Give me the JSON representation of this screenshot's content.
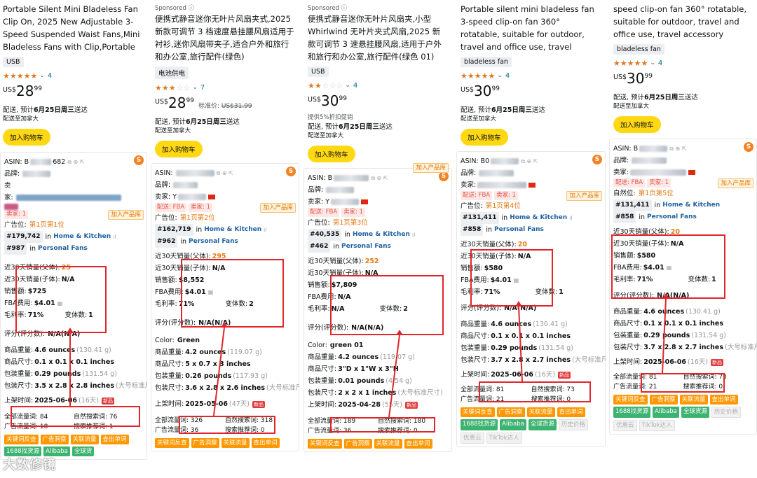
{
  "products": [
    {
      "title": "Portable Silent Mini Bladeless Fan Clip On, 2025 New Adjustable 3-Speed Suspended Waist Fans,Mini Bladeless Fans with Clip,Portable f...",
      "sponsored": "",
      "tag": "USB",
      "rating_stars": 5,
      "rating_count": "4",
      "currency": "US$",
      "price_main": "28",
      "price_frac": "99",
      "list_label": "",
      "list_price": "",
      "promo": "",
      "ship_prefix": "配送, 预计",
      "ship_date": "6月25日周三",
      "ship_suffix": "送达",
      "ship_to": "配送至加拿大",
      "cart": "加入购物车",
      "asin_label": "ASIN: B",
      "asin_tail": "682",
      "brand_label": "品牌:",
      "seller_label": "卖",
      "seller_label2": "家:",
      "fba_chip": "",
      "seller_count_chip": "卖家: 1",
      "add_btn": "加入产品库",
      "ad_pos_label": "广告位:",
      "ad_pos": "第1页第1位",
      "rank1_no": "#179,742",
      "rank1_in": "in",
      "rank1_cat": "Home & Kitchen",
      "rank2_no": "#987",
      "rank2_in": "in",
      "rank2_cat": "Personal Fans",
      "sales_parent_label": "近30天销量(父体):",
      "sales_parent": "25",
      "sales_child_label": "近30天销量(子体):",
      "sales_child": "N/A",
      "revenue_label": "销售额:",
      "revenue": "$725",
      "fba_label": "FBA费用:",
      "fba": "$4.01",
      "margin_label": "毛利率:",
      "margin": "71%",
      "variants_label": "变体数:",
      "variants": "1",
      "review_label": "评分(评分数):",
      "review": "N/A(N/A)",
      "color_label": "",
      "color": "",
      "weight_label": "商品重量:",
      "weight": "4.6 ounces",
      "weight_g": "(130.41 g)",
      "dim_label": "商品尺寸:",
      "dim": "0.1 x 0.1 x 0.1 inches",
      "pkg_w_label": "包装重量:",
      "pkg_w": "0.29 pounds",
      "pkg_w_g": "(131.54 g)",
      "pkg_d_label": "包装尺寸:",
      "pkg_d": "3.5 x 2.8 x 2.8 inches",
      "pkg_d_note": "(大号标准尺寸)",
      "launch_label": "上架时间:",
      "launch": "2025-06-06",
      "launch_days": "(16天)",
      "new_badge": "新品",
      "kw_total_label": "全部流量词:",
      "kw_total": "84",
      "kw_natural_label": "自然搜索词:",
      "kw_natural": "76",
      "kw_ad_label": "广告流量词:",
      "kw_ad": "18",
      "kw_rec_label": "搜索推荐词:",
      "kw_rec": "1",
      "action_buttons": [
        "关键词反查",
        "广告洞察",
        "关联流量",
        "查出单词"
      ],
      "extra_buttons": [
        "1688找货源",
        "Alibaba",
        "全球货"
      ]
    },
    {
      "title": "便携式静音迷你无叶片风扇夹式,2025 新款可调节 3 档速度悬挂腰风扇适用于衬衫,迷你风扇带夹子,适合户外和旅行和办公室,旅行配件(绿色)",
      "sponsored": "Sponsored ⓘ",
      "tag": "电池供电",
      "rating_stars": 3,
      "rating_count": "7",
      "currency": "US$",
      "price_main": "28",
      "price_frac": "99",
      "list_label": "标准价:",
      "list_price": "US$31.99",
      "promo": "",
      "ship_prefix": "配送, 预计",
      "ship_date": "6月25日周三",
      "ship_suffix": "送达",
      "ship_to": "配送至加拿大",
      "cart": "加入购物车",
      "asin_label": "ASIN:",
      "asin_tail": "",
      "brand_label": "品牌:",
      "seller_label": "卖家: Y",
      "seller_label2": "",
      "fba_chip": "配送: FBA",
      "seller_count_chip": "卖家: 1",
      "add_btn": "加入产品库",
      "ad_pos_label": "广告位:",
      "ad_pos": "第1页第2位",
      "rank1_no": "#162,719",
      "rank1_in": "in",
      "rank1_cat": "Home & Kitchen",
      "rank2_no": "#962",
      "rank2_in": "in",
      "rank2_cat": "Personal Fans",
      "sales_parent_label": "近30天销量(父体):",
      "sales_parent": "295",
      "sales_child_label": "近30天销量(子体):",
      "sales_child": "N/A",
      "revenue_label": "销售额:",
      "revenue": "$8,552",
      "fba_label": "FBA费用:",
      "fba": "$4.01",
      "margin_label": "毛利率:",
      "margin": "71%",
      "variants_label": "变体数:",
      "variants": "2",
      "review_label": "评分(评分数):",
      "review": "N/A(N/A)",
      "color_label": "Color:",
      "color": "Green",
      "weight_label": "商品重量:",
      "weight": "4.2 ounces",
      "weight_g": "(119.07 g)",
      "dim_label": "商品尺寸:",
      "dim": "5 x 0.7 x 3 inches",
      "pkg_w_label": "包装重量:",
      "pkg_w": "0.26 pounds",
      "pkg_w_g": "(117.93 g)",
      "pkg_d_label": "包装尺寸:",
      "pkg_d": "3.6 x 2.8 x 2.6 inches",
      "pkg_d_note": "(大号标准尺寸)",
      "launch_label": "上架时间:",
      "launch": "2025-05-06",
      "launch_days": "(47天)",
      "new_badge": "新品",
      "kw_total_label": "全部流量词:",
      "kw_total": "326",
      "kw_natural_label": "自然搜索词:",
      "kw_natural": "318",
      "kw_ad_label": "广告流量词:",
      "kw_ad": "36",
      "kw_rec_label": "搜索推荐词:",
      "kw_rec": "0",
      "action_buttons": [
        "关键词反查",
        "广告洞察",
        "关联流量",
        "查出单词"
      ],
      "extra_buttons": []
    },
    {
      "title": "便携式静音迷你无叶片风扇夹,小型 Whirlwind 无叶片夹式风扇,2025 新款可调节 3 速悬挂腰风扇,适用于户外和旅行和办公室,旅行配件(绿色 01)",
      "sponsored": "Sponsored ⓘ",
      "tag": "USB",
      "rating_stars": 2,
      "rating_count": "4",
      "currency": "US$",
      "price_main": "30",
      "price_frac": "99",
      "list_label": "",
      "list_price": "",
      "promo": "提供5%折扣促销",
      "ship_prefix": "配送, 预计",
      "ship_date": "6月25日周三",
      "ship_suffix": "送达",
      "ship_to": "配送至加拿大",
      "cart": "加入购物车",
      "asin_label": "ASIN: B",
      "asin_tail": "",
      "brand_label": "品牌:",
      "seller_label": "卖家: Y",
      "seller_label2": "",
      "fba_chip": "配送: FBA",
      "seller_count_chip": "卖家: 1",
      "add_btn": "加入产品库",
      "ad_pos_label": "广告位:",
      "ad_pos": "第1页第3位",
      "rank1_no": "#40,535",
      "rank1_in": "in",
      "rank1_cat": "Home & Kitchen",
      "rank2_no": "#462",
      "rank2_in": "in",
      "rank2_cat": "Personal Fans",
      "sales_parent_label": "近30天销量(父体):",
      "sales_parent": "252",
      "sales_child_label": "近30天销量(子体):",
      "sales_child": "N/A",
      "revenue_label": "销售额:",
      "revenue": "$7,809",
      "fba_label": "FBA费用:",
      "fba": "N/A",
      "margin_label": "毛利率:",
      "margin": "N/A",
      "variants_label": "变体数:",
      "variants": "2",
      "review_label": "评分(评分数):",
      "review": "N/A(N/A)",
      "color_label": "Color:",
      "color": "green 01",
      "weight_label": "商品重量:",
      "weight": "4.2 ounces",
      "weight_g": "(119.07 g)",
      "dim_label": "商品尺寸:",
      "dim": "3\"D x 1\"W x 3\"H",
      "pkg_w_label": "包装重量:",
      "pkg_w": "0.01 pounds",
      "pkg_w_g": "(4.54 g)",
      "pkg_d_label": "包装尺寸:",
      "pkg_d": "2 x 2 x 1 inches",
      "pkg_d_note": "(大号标准尺寸)",
      "launch_label": "上架时间:",
      "launch": "2025-04-28",
      "launch_days": "(55天)",
      "new_badge": "新品",
      "kw_total_label": "全部流量词:",
      "kw_total": "189",
      "kw_natural_label": "自然搜索词:",
      "kw_natural": "180",
      "kw_ad_label": "广告流量词:",
      "kw_ad": "36",
      "kw_rec_label": "搜索推荐词:",
      "kw_rec": "0",
      "action_buttons": [
        "关键词反查",
        "广告洞察",
        "关联流量",
        "查出单词"
      ],
      "extra_buttons": []
    },
    {
      "title": "Portable silent mini bladeless fan 3-speed clip-on fan 360° rotatable, suitable for outdoor, travel and office use, travel accessory (Green)",
      "sponsored": "",
      "tag": "bladeless fan",
      "rating_stars": 5,
      "rating_count": "4",
      "currency": "US$",
      "price_main": "30",
      "price_frac": "99",
      "list_label": "",
      "list_price": "",
      "promo": "",
      "ship_prefix": "配送, 预计",
      "ship_date": "6月25日周三",
      "ship_suffix": "送达",
      "ship_to": "配送至加拿大",
      "cart": "加入购物车",
      "asin_label": "ASIN: B0",
      "asin_tail": "",
      "brand_label": "品牌:",
      "seller_label": "卖家:",
      "seller_label2": "",
      "fba_chip": "配送: FBA",
      "seller_count_chip": "卖家: 1",
      "add_btn": "加入产品库",
      "ad_pos_label": "广告位:",
      "ad_pos": "第1页第4位",
      "rank1_no": "#131,411",
      "rank1_in": "in",
      "rank1_cat": "Home & Kitchen",
      "rank2_no": "#858",
      "rank2_in": "in",
      "rank2_cat": "Personal Fans",
      "sales_parent_label": "近30天销量(父体):",
      "sales_parent": "20",
      "sales_child_label": "近30天销量(子体):",
      "sales_child": "N/A",
      "revenue_label": "销售额:",
      "revenue": "$580",
      "fba_label": "FBA费用:",
      "fba": "$4.01",
      "margin_label": "毛利率:",
      "margin": "71%",
      "variants_label": "变体数:",
      "variants": "1",
      "review_label": "评分(评分数):",
      "review": "N/A(N/A)",
      "color_label": "",
      "color": "",
      "weight_label": "商品重量:",
      "weight": "4.6 ounces",
      "weight_g": "(130.41 g)",
      "dim_label": "商品尺寸:",
      "dim": "0.1 x 0.1 x 0.1 inches",
      "pkg_w_label": "包装重量:",
      "pkg_w": "0.29 pounds",
      "pkg_w_g": "(131.54 g)",
      "pkg_d_label": "包装尺寸:",
      "pkg_d": "3.7 x 2.8 x 2.7 inches",
      "pkg_d_note": "(大号标准尺寸)",
      "launch_label": "上架时间:",
      "launch": "2025-06-06",
      "launch_days": "(16天)",
      "new_badge": "新品",
      "kw_total_label": "全部流量词:",
      "kw_total": "81",
      "kw_natural_label": "自然搜索词:",
      "kw_natural": "73",
      "kw_ad_label": "广告流量词:",
      "kw_ad": "21",
      "kw_rec_label": "搜索推荐词:",
      "kw_rec": "0",
      "action_buttons": [
        "关键词反查",
        "广告洞察",
        "关联流量",
        "查出单词"
      ],
      "extra_buttons": [
        "1688找货源",
        "Alibaba",
        "全球货源"
      ],
      "gray_buttons": [
        "历史价格",
        "优惠云",
        "TikTok达人"
      ]
    },
    {
      "title": "speed clip-on fan 360° rotatable, suitable for outdoor, travel and office use, travel accessory (Green)",
      "sponsored": "",
      "tag": "bladeless fan",
      "rating_stars": 5,
      "rating_count": "4",
      "currency": "US$",
      "price_main": "30",
      "price_frac": "99",
      "list_label": "",
      "list_price": "",
      "promo": "",
      "ship_prefix": "配送, 预计",
      "ship_date": "6月25日周三",
      "ship_suffix": "送达",
      "ship_to": "配送至加拿大",
      "cart": "加入购物车",
      "asin_label": "ASIN: B",
      "asin_tail": "",
      "brand_label": "品牌:",
      "seller_label": "卖家:",
      "seller_label2": "",
      "fba_chip": "配送: FBA",
      "seller_count_chip": "卖家: 1",
      "add_btn": "加入产品库",
      "ad_pos_label": "",
      "ad_pos": "",
      "natural_pos_label": "自然位:",
      "natural_pos": "第1页第5位",
      "rank1_no": "#131,411",
      "rank1_in": "in",
      "rank1_cat": "Home & Kitchen",
      "rank2_no": "#858",
      "rank2_in": "in",
      "rank2_cat": "Personal Fans",
      "sales_parent_label": "近30天销量(父体):",
      "sales_parent": "20",
      "sales_child_label": "近30天销量(子体):",
      "sales_child": "N/A",
      "revenue_label": "销售额:",
      "revenue": "$580",
      "fba_label": "FBA费用:",
      "fba": "$4.01",
      "margin_label": "毛利率:",
      "margin": "71%",
      "variants_label": "变体数:",
      "variants": "1",
      "review_label": "评分(评分数):",
      "review": "N/A(N/A)",
      "color_label": "",
      "color": "",
      "weight_label": "商品重量:",
      "weight": "4.6 ounces",
      "weight_g": "(130.41 g)",
      "dim_label": "商品尺寸:",
      "dim": "0.1 x 0.1 x 0.1 inches",
      "pkg_w_label": "包装重量:",
      "pkg_w": "0.29 pounds",
      "pkg_w_g": "(131.54 g)",
      "pkg_d_label": "包装尺寸:",
      "pkg_d": "3.7 x 2.8 x 2.7 inches",
      "pkg_d_note": "(大号标准尺寸)",
      "launch_label": "上架时间:",
      "launch": "2025-06-06",
      "launch_days": "(16天)",
      "new_badge": "新品",
      "kw_total_label": "全部流量词:",
      "kw_total": "81",
      "kw_natural_label": "自然搜索词:",
      "kw_natural": "73",
      "kw_ad_label": "广告流量词:",
      "kw_ad": "21",
      "kw_rec_label": "搜索推荐词:",
      "kw_rec": "0",
      "action_buttons": [
        "关键词反查",
        "广告洞察",
        "关联流量",
        "查出单词"
      ],
      "extra_buttons": [
        "1688找货源",
        "Alibaba",
        "全球货源"
      ],
      "gray_buttons": [
        "历史价格",
        "优惠云",
        "TikTok达人"
      ]
    }
  ],
  "watermark": "大数修镜"
}
